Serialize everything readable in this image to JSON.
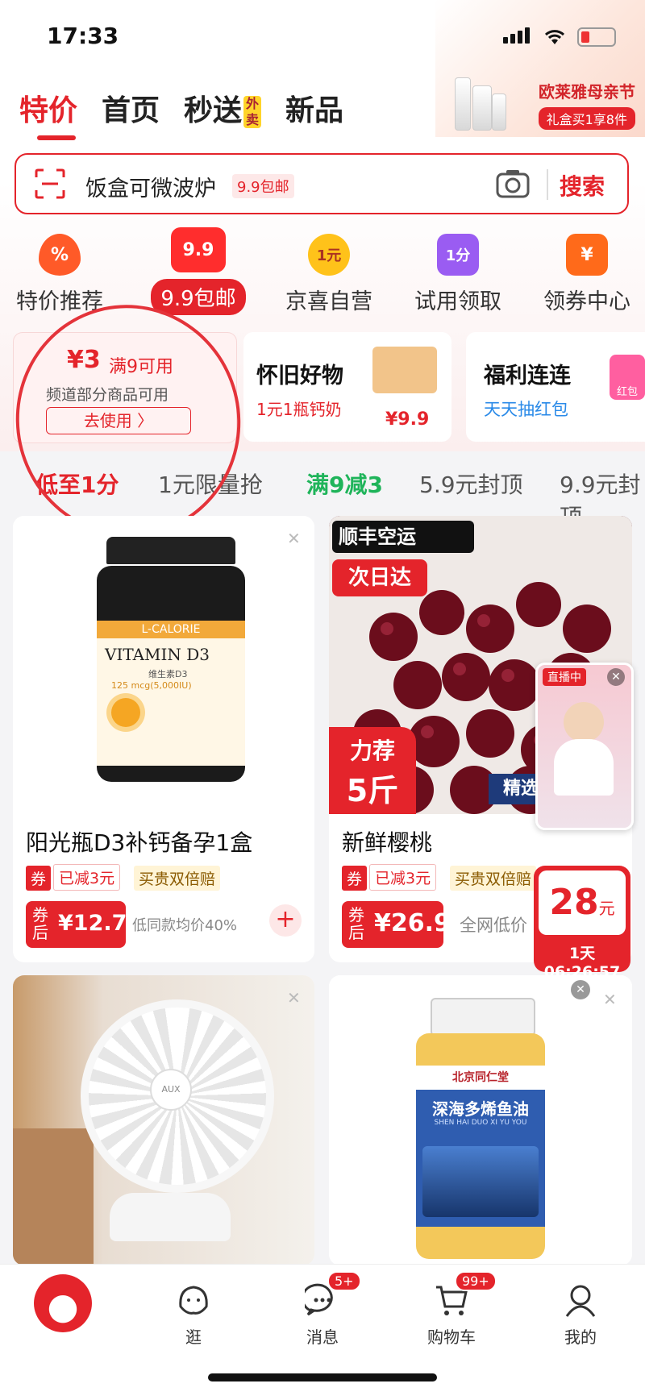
{
  "status": {
    "time": "17:33"
  },
  "header": {
    "tabs": [
      {
        "label": "特价",
        "active": true
      },
      {
        "label": "首页"
      },
      {
        "label": "秒送",
        "badge": "外卖"
      },
      {
        "label": "新品"
      }
    ],
    "promo": {
      "title": "欧莱雅母亲节",
      "subtitle": "礼盒买1享8件"
    }
  },
  "search": {
    "text": "饭盒可微波炉",
    "tag": "9.9包邮",
    "button": "搜索"
  },
  "categories": [
    {
      "label": "特价推荐",
      "icon_text": "%"
    },
    {
      "label": "9.9包邮",
      "icon_text": "9.9"
    },
    {
      "label": "京喜自营",
      "icon_text": "1元"
    },
    {
      "label": "试用领取",
      "icon_text": "1分"
    },
    {
      "label": "领券中心",
      "icon_text": "¥"
    }
  ],
  "coupon_card": {
    "amount": "¥3",
    "condition": "满9可用",
    "desc": "频道部分商品可用",
    "button": "去使用 〉"
  },
  "promo_card_1": {
    "title": "怀旧好物",
    "subtitle": "1元1瓶钙奶",
    "price": "¥9.9"
  },
  "promo_card_2": {
    "title": "福利连连",
    "subtitle": "天天抽红包",
    "tag": "红包"
  },
  "filters": [
    "低至1分",
    "1元限量抢",
    "满9减3",
    "5.9元封顶",
    "9.9元封顶"
  ],
  "products": [
    {
      "name": "阳光瓶D3补钙备孕1盒",
      "tags": [
        "券",
        "已减3元",
        "买贵双倍赔"
      ],
      "price_prefix": "券后",
      "price": "¥12.74",
      "note": "低同款均价40%",
      "image_text": {
        "brand": "L-CALORIE",
        "title": "VITAMIN D3",
        "sub": "维生素D3",
        "dose": "125 mcg(5,000IU)"
      }
    },
    {
      "name": "新鲜樱桃",
      "tags": [
        "券",
        "已减3元",
        "买贵双倍赔"
      ],
      "price_prefix": "券后",
      "price": "¥26.9",
      "note": "全网低价",
      "image_text": {
        "shipping": "顺丰空运",
        "next_day": "次日达",
        "weight_1": "力荐",
        "weight_2": "5斤",
        "select": "精选"
      }
    },
    {
      "name": "",
      "image_text": {
        "brand": "AUX"
      }
    },
    {
      "name": "",
      "image_text": {
        "brand": "北京同仁堂",
        "title": "深海多烯鱼油",
        "sub": "SHEN HAI DUO XI YU YOU"
      }
    }
  ],
  "live": {
    "label": "直播中"
  },
  "countdown": {
    "price": "28",
    "unit": "元",
    "timer": "1天06:26:57"
  },
  "nav": [
    {
      "label": ""
    },
    {
      "label": "逛"
    },
    {
      "label": "消息",
      "badge": "5+"
    },
    {
      "label": "购物车",
      "badge": "99+"
    },
    {
      "label": "我的"
    }
  ]
}
